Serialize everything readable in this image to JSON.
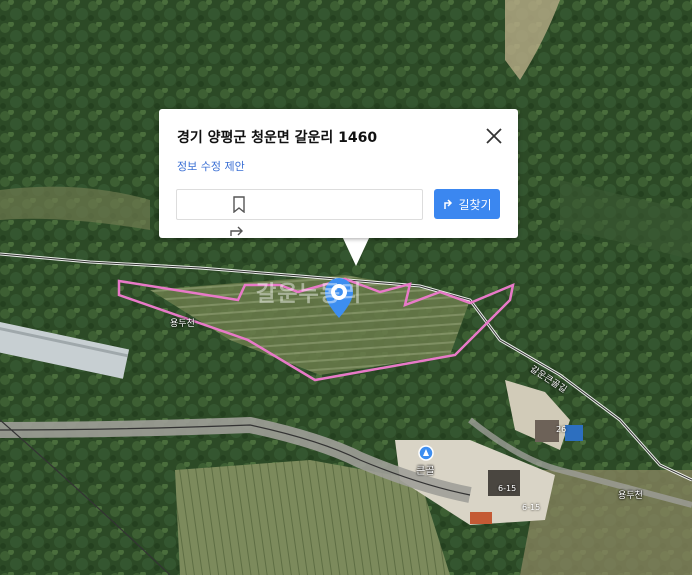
{
  "popup": {
    "title": "경기 양평군 청운면 갈운리 1460",
    "edit_link": "정보 수정 제안",
    "route_label": "길찾기",
    "icons": [
      "close-icon",
      "bookmark-icon",
      "share-icon",
      "route-icon"
    ]
  },
  "map": {
    "watermark": "갈운누동리",
    "road_labels": [
      "용두천",
      "갈운큰골길",
      "용두천"
    ],
    "place_label": "큰골",
    "building_numbers": [
      "26",
      "6-15",
      "6-15"
    ],
    "colors": {
      "parcel_outline": "#e87ac8",
      "marker": "#3d8ef0",
      "route_button": "#3b87f0"
    }
  }
}
